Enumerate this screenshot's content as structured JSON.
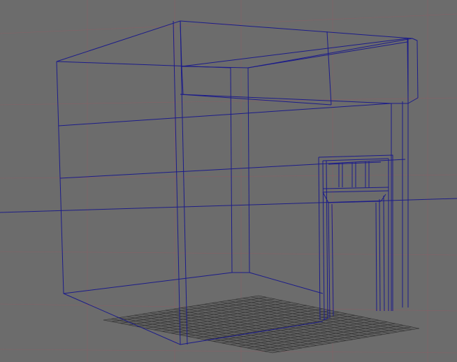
{
  "viewport": {
    "background": "#6c6c6c",
    "grid_color": "#8a5f66",
    "wireframe_color": "#1c1c8a",
    "floor_grid_color": "#2f2f2f",
    "view_mode": "wireframe"
  },
  "scene": {
    "objects": [
      "room-box",
      "ceiling-soffit",
      "doorway-frame",
      "transom-window",
      "floor-grid"
    ]
  }
}
